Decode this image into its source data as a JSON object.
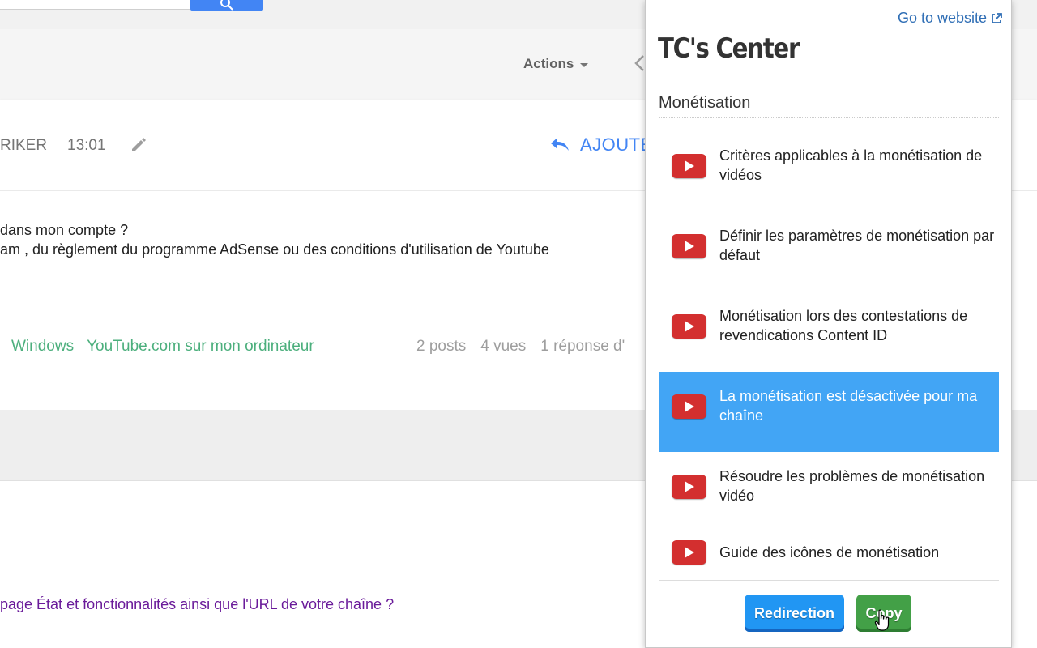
{
  "forum": {
    "toolbar": {
      "actions_label": "Actions"
    },
    "post": {
      "author": "RIKER",
      "time": "13:01",
      "reply_label": "AJOUTE",
      "body_line1": "dans mon compte ?",
      "body_line2": "am , du règlement du programme AdSense ou des conditions d'utilisation de Youtube",
      "tags": [
        "Windows",
        "YouTube.com sur mon ordinateur"
      ],
      "stats": {
        "posts": "2 posts",
        "views": "4 vues",
        "replies": "1 réponse d'"
      }
    },
    "lower_link": "page État et fonctionnalités ainsi que l'URL de votre chaîne ?"
  },
  "popup": {
    "goto_label": "Go to website",
    "title": "TC's Center",
    "section": "Monétisation",
    "items": [
      {
        "label": "Critères applicables à la monétisation de vidéos",
        "icon": "youtube-icon"
      },
      {
        "label": "Définir les paramètres de monétisation par défaut",
        "icon": "youtube-icon"
      },
      {
        "label": "Monétisation lors des contestations de revendications Content ID",
        "icon": "youtube-icon"
      },
      {
        "label": "La monétisation est désactivée pour ma chaîne",
        "icon": "youtube-icon"
      },
      {
        "label": "Résoudre les problèmes de monétisation vidéo",
        "icon": "youtube-icon"
      },
      {
        "label": "Guide des icônes de monétisation",
        "icon": "youtube-icon"
      }
    ],
    "selected_index": 3,
    "buttons": {
      "redirect": "Redirection",
      "copy": "Copy"
    },
    "colors": {
      "selected": "#42a5f5",
      "redirect": "#2196f3",
      "copy": "#43a047",
      "youtube": "#d32f2f"
    }
  }
}
